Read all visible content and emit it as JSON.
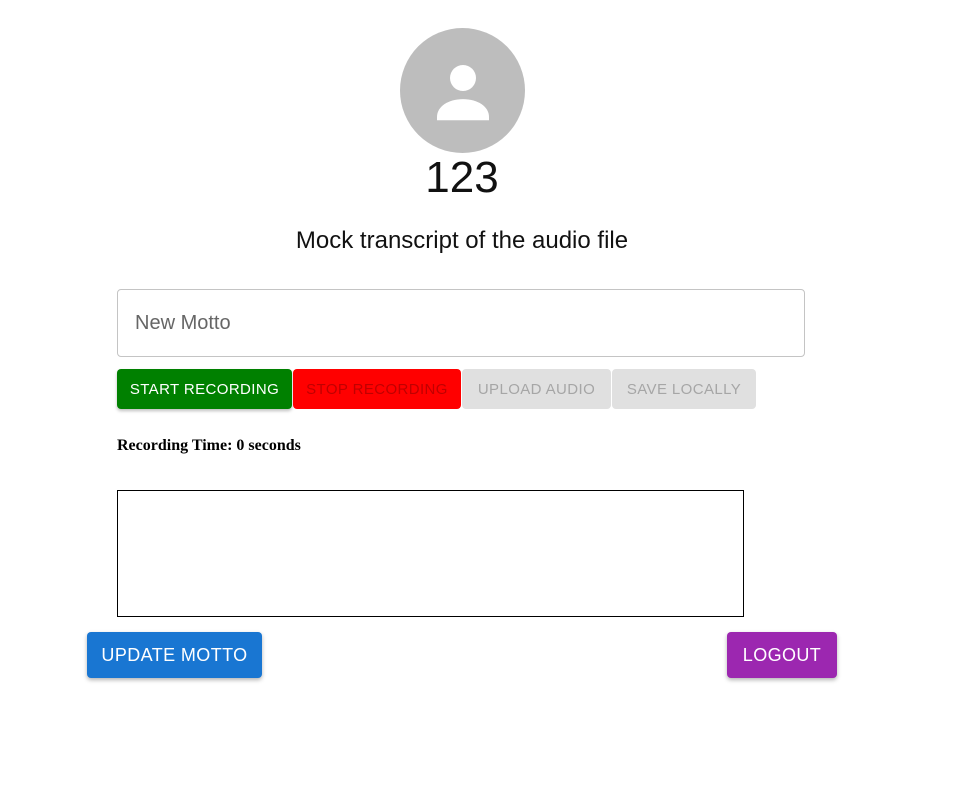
{
  "profile": {
    "avatar_icon": "person-icon",
    "username": "123"
  },
  "transcript": "Mock transcript of the audio file",
  "motto_input": {
    "placeholder": "New Motto",
    "value": ""
  },
  "recording_controls": {
    "start_label": "Start Recording",
    "stop_label": "Stop Recording",
    "upload_label": "Upload Audio",
    "save_label": "Save Locally"
  },
  "recording_time": "Recording Time: 0 seconds",
  "actions": {
    "update_label": "Update Motto",
    "logout_label": "Logout"
  },
  "colors": {
    "start": "#008000",
    "stop": "#ff0000",
    "disabled": "#e0e0e0",
    "update": "#1976d2",
    "logout": "#9c27b0",
    "avatar": "#bdbdbd"
  }
}
